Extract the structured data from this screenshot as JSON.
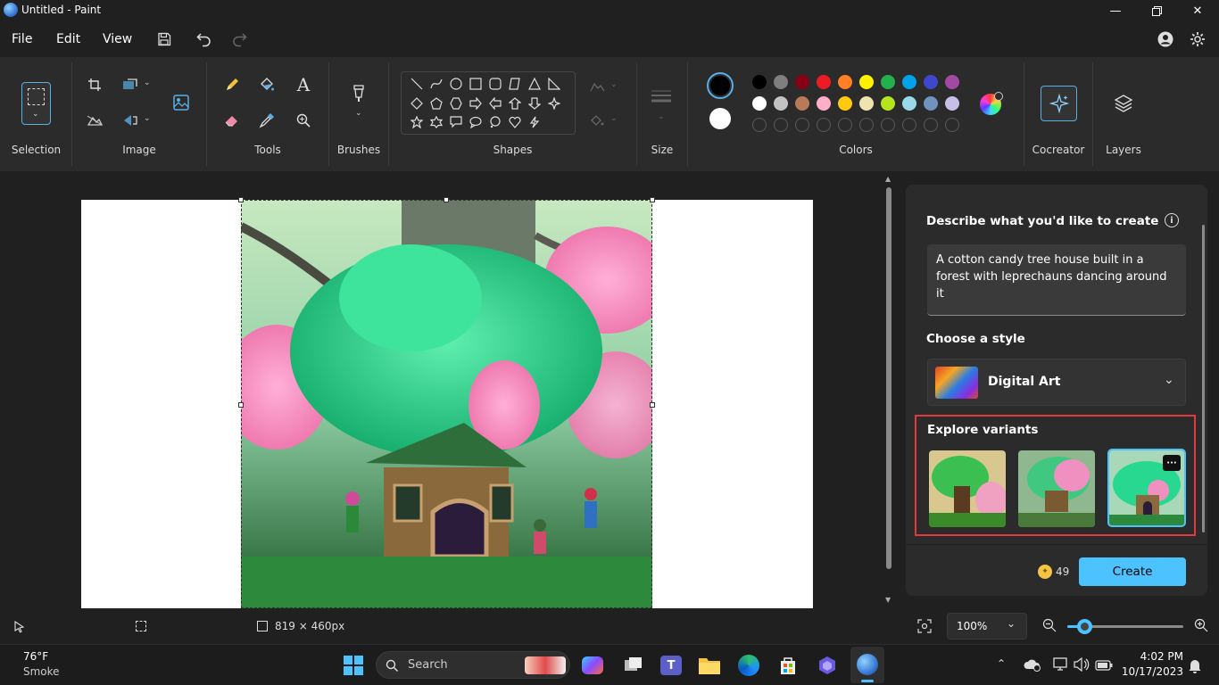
{
  "window": {
    "title": "Untitled - Paint"
  },
  "menu": {
    "file": "File",
    "edit": "Edit",
    "view": "View"
  },
  "ribbon": {
    "groups": {
      "selection": "Selection",
      "image": "Image",
      "tools": "Tools",
      "brushes": "Brushes",
      "shapes": "Shapes",
      "size": "Size",
      "colors": "Colors",
      "cocreator": "Cocreator",
      "layers": "Layers"
    },
    "active_colors": {
      "primary": "#000000",
      "secondary": "#ffffff"
    },
    "palette_row1": [
      "#000000",
      "#7f7f7f",
      "#880015",
      "#ed1c24",
      "#ff7f27",
      "#fff200",
      "#22b14c",
      "#00a2e8",
      "#3f48cc",
      "#a349a4"
    ],
    "palette_row2": [
      "#ffffff",
      "#c3c3c3",
      "#b97a57",
      "#ffaec9",
      "#ffc90e",
      "#efe4b0",
      "#b5e61d",
      "#99d9ea",
      "#7092be",
      "#c8bfe7"
    ]
  },
  "cocreator": {
    "describe_label": "Describe what you'd like to create",
    "prompt": "A cotton candy tree house built in a forest with leprechauns dancing around it",
    "style_label": "Choose a style",
    "style_value": "Digital Art",
    "variants_label": "Explore variants",
    "credits": "49",
    "create_label": "Create",
    "highlight_color": "#e0393e",
    "accent": "#4cc2ff"
  },
  "status": {
    "dimensions": "819 × 460px",
    "zoom": "100%",
    "zoom_level": 0.1
  },
  "taskbar": {
    "weather_temp": "76°F",
    "weather_desc": "Smoke",
    "search_label": "Search",
    "time": "4:02 PM",
    "date": "10/17/2023"
  }
}
